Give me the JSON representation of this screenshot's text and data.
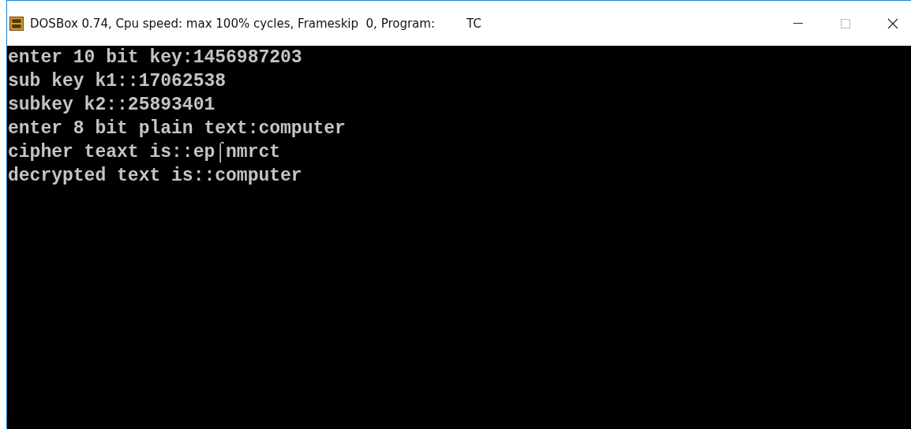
{
  "window": {
    "title": "DOSBox 0.74, Cpu speed: max 100% cycles, Frameskip  0, Program:",
    "program": "TC"
  },
  "console": {
    "lines": [
      "enter 10 bit key:1456987203",
      "sub key k1::17062538",
      "subkey k2::25893401",
      "enter 8 bit plain text:computer",
      "cipher teaxt is::ep⌠nmrct",
      "decrypted text is::computer"
    ]
  }
}
